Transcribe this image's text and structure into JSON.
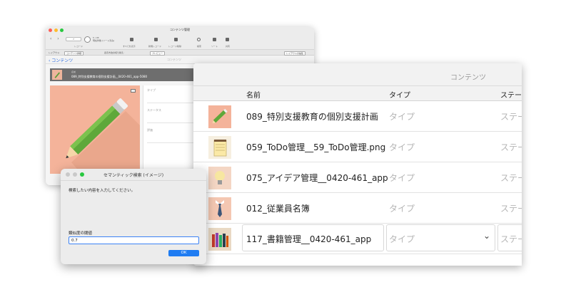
{
  "back_window": {
    "title": "コンテンツ管理",
    "record_field": "7",
    "record_count": "5 / 95",
    "record_sub": "現在件数 (ソート済み)",
    "toolbar_labels": [
      "レコード",
      "すべてを表示",
      "新規レコード",
      "レコード削除",
      "検索",
      "ソート",
      "共有"
    ],
    "layout_label": "レイアウト:",
    "layout_value": "コンテンツ詳細",
    "view_label": "表示方法の切り替え:",
    "preview_button": "プレビュー",
    "edit_layout_button": "レイアウトの編集",
    "back_link": "‹ コンテンツ",
    "header_title": "コンテンツ",
    "selected_label": "名前",
    "selected_name": "089_特別支援教育の個別支援計画__0420-461_app-5080",
    "fields": [
      "タイプ",
      "ステータス",
      "評価"
    ]
  },
  "front_window": {
    "title": "コンテンツ",
    "columns": {
      "name": "名前",
      "type": "タイプ",
      "status": "ステータ"
    },
    "rows": [
      {
        "name": "089_特別支援教育の個別支援計画",
        "type": "タイプ",
        "status": "ステー",
        "icon": "pencil-icon"
      },
      {
        "name": "059_ToDo管理__59_ToDo管理.png",
        "type": "タイプ",
        "status": "ステー",
        "icon": "notepad-icon"
      },
      {
        "name": "075_アイデア管理__0420-461_app",
        "type": "タイプ",
        "status": "ステー",
        "icon": "lightbulb-icon"
      },
      {
        "name": "012_従業員名簿",
        "type": "タイプ",
        "status": "ステー",
        "icon": "necktie-icon"
      },
      {
        "name": "117_書籍管理__0420-461_app",
        "type": "タイプ",
        "status": "ステー",
        "icon": "books-icon"
      }
    ]
  },
  "dialog": {
    "title": "セマンティック検索 (イメージ)",
    "prompt": "検索したい内容を入力してください。",
    "threshold_label": "類似度の閾値",
    "threshold_value": "0.7",
    "ok_label": "OK"
  },
  "colors": {
    "accent": "#1f7cf2",
    "thumb_bg": "#f4b39a"
  }
}
